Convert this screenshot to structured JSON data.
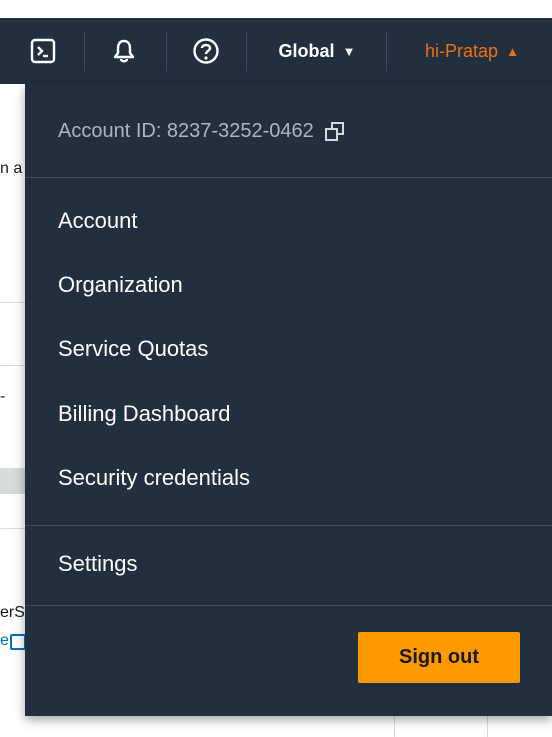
{
  "navbar": {
    "icons": {
      "cloudshell": "cloudshell-icon",
      "notifications": "bell-icon",
      "help": "help-icon"
    },
    "region": {
      "label": "Global",
      "caret": "▼"
    },
    "user": {
      "label": "hi-Pratap",
      "caret": "▲"
    }
  },
  "background": {
    "fragment1": "n a",
    "fragment2": "-",
    "fragment3": "erS",
    "fragment4": "e"
  },
  "dropdown": {
    "account_id": "Account ID: 8237-3252-0462",
    "items": [
      {
        "label": "Account"
      },
      {
        "label": "Organization"
      },
      {
        "label": "Service Quotas"
      },
      {
        "label": "Billing Dashboard"
      },
      {
        "label": "Security credentials"
      }
    ],
    "settings_label": "Settings",
    "sign_out_label": "Sign out"
  },
  "colors": {
    "navbar_bg": "#232f3e",
    "user_accent": "#ec7211",
    "sign_out_bg": "#ff9900"
  }
}
